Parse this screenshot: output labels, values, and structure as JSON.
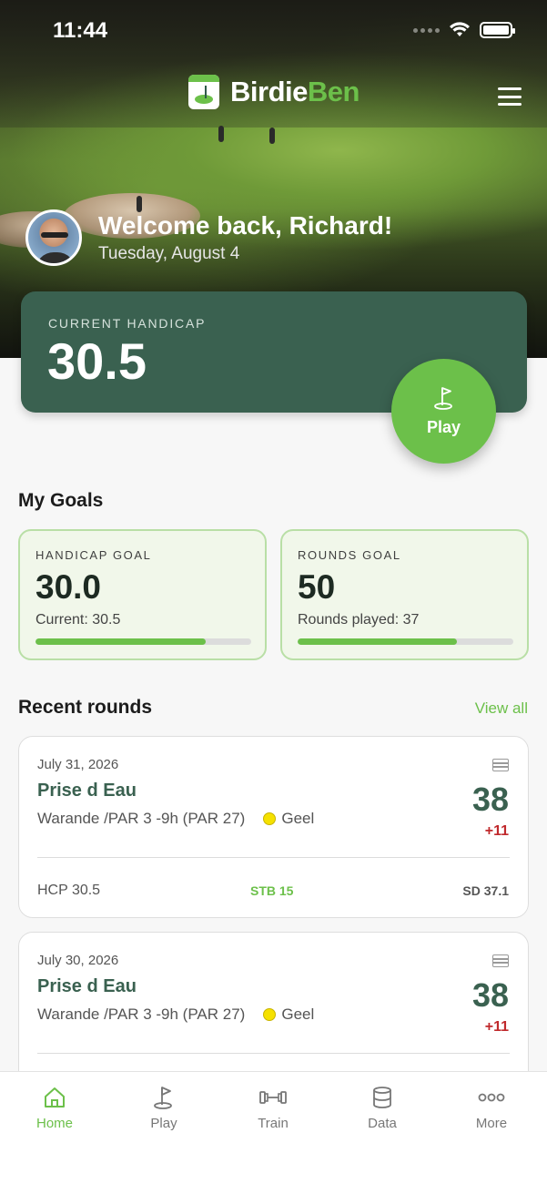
{
  "status_bar": {
    "time": "11:44"
  },
  "app": {
    "name_part1": "Birdie",
    "name_part2": "Ben"
  },
  "welcome": {
    "greeting": "Welcome back, Richard!",
    "date": "Tuesday, August 4"
  },
  "handicap": {
    "label": "CURRENT HANDICAP",
    "value": "30.5"
  },
  "play_button": {
    "label": "Play"
  },
  "goals": {
    "title": "My Goals",
    "items": [
      {
        "label": "HANDICAP GOAL",
        "value": "30.0",
        "sub": "Current: 30.5",
        "progress": 0.79
      },
      {
        "label": "ROUNDS GOAL",
        "value": "50",
        "sub": "Rounds played: 37",
        "progress": 0.74
      }
    ]
  },
  "recent_rounds": {
    "title": "Recent rounds",
    "view_all": "View all",
    "items": [
      {
        "date": "July 31, 2026",
        "course": "Prise d Eau",
        "layout": "Warande /PAR 3 -9h (PAR 27)",
        "tee": "Geel",
        "score": "38",
        "over": "+11",
        "hcp": "HCP 30.5",
        "stb": "STB 15",
        "sd": "SD 37.1"
      },
      {
        "date": "July 30, 2026",
        "course": "Prise d Eau",
        "layout": "Warande /PAR 3 -9h (PAR 27)",
        "tee": "Geel",
        "score": "38",
        "over": "+11"
      }
    ]
  },
  "colors": {
    "accent": "#6cc04a",
    "primary": "#3a6150",
    "over_par": "#c0292c",
    "tee_yellow": "#f5e100"
  },
  "tabs": [
    {
      "label": "Home",
      "icon": "home-icon",
      "active": true
    },
    {
      "label": "Play",
      "icon": "flag-icon",
      "active": false
    },
    {
      "label": "Train",
      "icon": "dumbbell-icon",
      "active": false
    },
    {
      "label": "Data",
      "icon": "database-icon",
      "active": false
    },
    {
      "label": "More",
      "icon": "more-dots-icon",
      "active": false
    }
  ]
}
